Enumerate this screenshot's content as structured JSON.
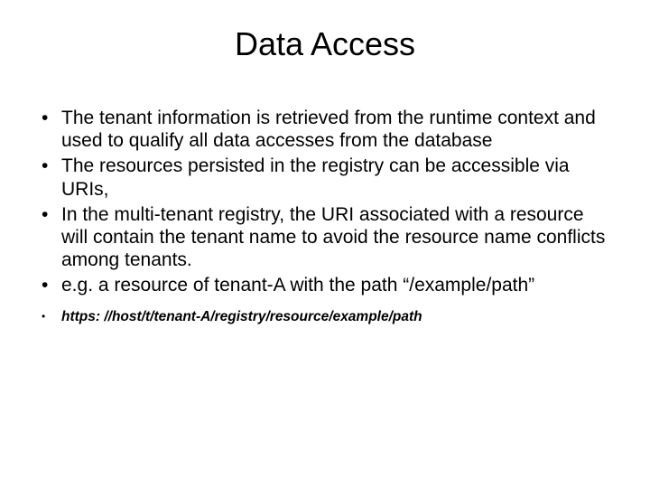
{
  "title": "Data Access",
  "bullets": [
    "The tenant information is retrieved from the runtime context and used to qualify all data accesses from the database",
    "The resources persisted in the registry can be accessible via URIs,",
    "In the multi-tenant registry, the URI associated with a resource will contain the tenant name to avoid the resource name conflicts among tenants.",
    "e.g. a resource of tenant-A with the path “/example/path”"
  ],
  "small_bullet": "https: //host/t/tenant-A/registry/resource/example/path"
}
